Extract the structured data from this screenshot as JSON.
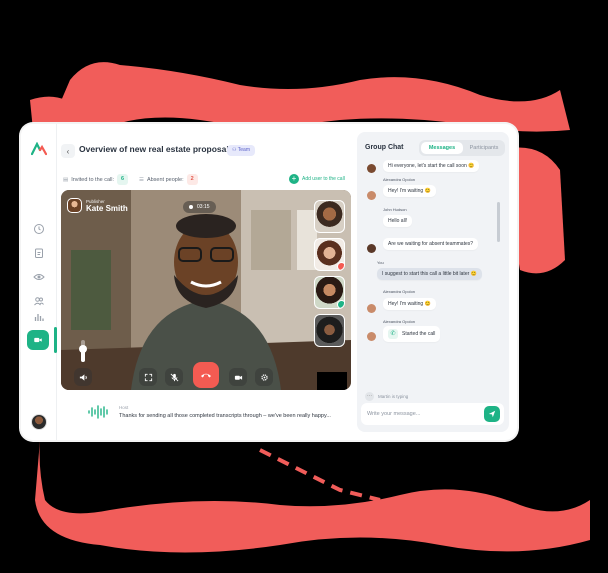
{
  "colors": {
    "accent": "#1eb386",
    "danger": "#f45b52",
    "decoration": "#f15d5a"
  },
  "header": {
    "title": "Overview of new real estate proposals",
    "team_badge": "Team",
    "back_icon": "chevron-left-icon"
  },
  "meta": {
    "invited_label": "Invited to the call:",
    "invited_count": "6",
    "absent_label": "Absent people:",
    "absent_count": "2",
    "add_user_label": "Add user to the call"
  },
  "video": {
    "publisher_label": "Publisher",
    "publisher_name": "Kate Smith",
    "timer": "03:15",
    "volume_level": 0.6,
    "participants": [
      "participant-1",
      "participant-2",
      "participant-3",
      "participant-4"
    ]
  },
  "transcript": {
    "label": "Host",
    "text": "Thanks for sending all those completed transcripts through – we've been really happy..."
  },
  "chat": {
    "title": "Group Chat",
    "tabs": [
      "Messages",
      "Participants"
    ],
    "messages": [
      {
        "sender": "",
        "text": "Hi everyone, let's start the call soon 😊"
      },
      {
        "sender": "Alexandra Opolon",
        "text": "Hey! I'm waiting 😊"
      },
      {
        "sender": "John Hudson",
        "text": "Hello all!"
      },
      {
        "sender": "",
        "text": "Are we waiting for absent teammates?"
      },
      {
        "sender": "You",
        "text": "I suggest to start this call a little bit later 😊"
      },
      {
        "sender": "Alexandra Opolon",
        "text": "Hey! I'm waiting 😊"
      },
      {
        "sender": "Alexandra Opolon",
        "text": "Started the call"
      }
    ],
    "typing": "Martin is typing",
    "composer_placeholder": "Write your message..."
  }
}
